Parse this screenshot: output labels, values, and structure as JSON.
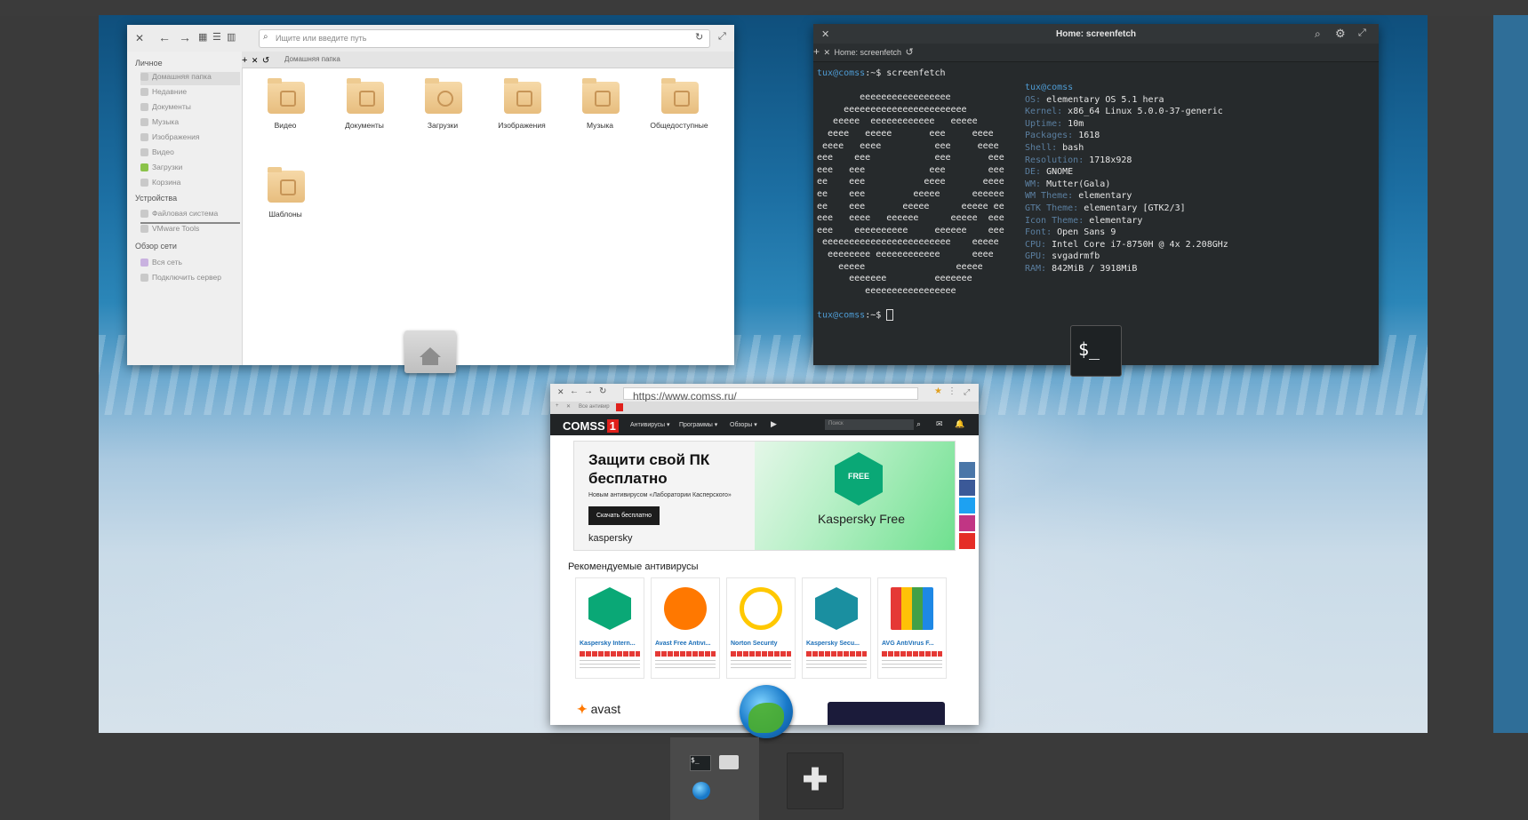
{
  "files": {
    "search_placeholder": "Ищите или введите путь",
    "tab_label": "Домашняя папка",
    "sidebar": {
      "personal_header": "Личное",
      "personal": [
        "Домашняя папка",
        "Недавние",
        "Документы",
        "Музыка",
        "Изображения",
        "Видео",
        "Загрузки",
        "Корзина"
      ],
      "devices_header": "Устройства",
      "devices": [
        "Файловая система",
        "VMware Tools"
      ],
      "network_header": "Обзор сети",
      "network": [
        "Вся сеть",
        "Подключить сервер"
      ]
    },
    "folders": [
      "Видео",
      "Документы",
      "Загрузки",
      "Изображения",
      "Музыка",
      "Общедоступные",
      "Шаблоны"
    ]
  },
  "terminal": {
    "title": "Home: screenfetch",
    "tab_label": "Home: screenfetch",
    "user": "tux@comss",
    "prompt_suffix": ":~$ ",
    "command": "screenfetch",
    "ascii_logo": [
      "        eeeeeeeeeeeeeeeee",
      "     eeeeeeeeeeeeeeeeeeeeeee",
      "   eeeee  eeeeeeeeeeee   eeeee",
      "  eeee   eeeee       eee     eeee",
      " eeee   eeee          eee     eeee",
      "eee    eee            eee       eee",
      "eee   eee            eee        eee",
      "ee    eee           eeee       eeee",
      "ee    eee         eeeee      eeeeee",
      "ee    eee       eeeee      eeeee ee",
      "eee   eeee   eeeeee      eeeee  eee",
      "eee    eeeeeeeeee     eeeeee    eee",
      " eeeeeeeeeeeeeeeeeeeeeeee    eeeee",
      "  eeeeeeee eeeeeeeeeeee      eeee",
      "    eeeee                 eeeee",
      "      eeeeeee         eeeeeee",
      "         eeeeeeeeeeeeeeeee"
    ],
    "info_user": "tux@comss",
    "info": [
      {
        "k": "OS:",
        "v": "elementary OS 5.1 hera"
      },
      {
        "k": "Kernel:",
        "v": "x86_64 Linux 5.0.0-37-generic"
      },
      {
        "k": "Uptime:",
        "v": "10m"
      },
      {
        "k": "Packages:",
        "v": "1618"
      },
      {
        "k": "Shell:",
        "v": "bash"
      },
      {
        "k": "Resolution:",
        "v": "1718x928"
      },
      {
        "k": "DE:",
        "v": "GNOME"
      },
      {
        "k": "WM:",
        "v": "Mutter(Gala)"
      },
      {
        "k": "WM Theme:",
        "v": "elementary"
      },
      {
        "k": "GTK Theme:",
        "v": "elementary [GTK2/3]"
      },
      {
        "k": "Icon Theme:",
        "v": "elementary"
      },
      {
        "k": "Font:",
        "v": "Open Sans 9"
      },
      {
        "k": "CPU:",
        "v": "Intel Core i7-8750H @ 4x 2.208GHz"
      },
      {
        "k": "GPU:",
        "v": "svgadrmfb"
      },
      {
        "k": "RAM:",
        "v": "842MiB / 3918MiB"
      }
    ],
    "icon_glyph": "$_"
  },
  "browser": {
    "url": "https://www.comss.ru/",
    "tab_label": "Все антивир",
    "logo": "COMSS",
    "logo_badge": "1",
    "nav": [
      "Антивирусы ▾",
      "Программы ▾",
      "Обзоры ▾"
    ],
    "search_placeholder": "Поиск",
    "banner": {
      "headline": "Защити свой ПК бесплатно",
      "sub": "Новым антивирусом «Лаборатории Касперского»",
      "button": "Скачать бесплатно",
      "brand": "kaspersky",
      "badge": "FREE",
      "product": "Kaspersky Free"
    },
    "section_title": "Рекомендуемые антивирусы",
    "cards": [
      {
        "name": "Kaspersky Intern...",
        "color": "#0aa876"
      },
      {
        "name": "Avast Free Antivi...",
        "color": "#ff7800"
      },
      {
        "name": "Norton Security",
        "color": "#ffc800"
      },
      {
        "name": "Kaspersky Secu...",
        "color": "#1a8fa0"
      },
      {
        "name": "AVG AntiVirus F...",
        "color": "#e53935"
      }
    ],
    "footer_logo": "avast",
    "social_colors": [
      "#4a76a8",
      "#3b5998",
      "#1da1f2",
      "#c13584",
      "#e52d27"
    ]
  },
  "dock": {
    "add_label": "✚",
    "term_glyph": "$_"
  }
}
